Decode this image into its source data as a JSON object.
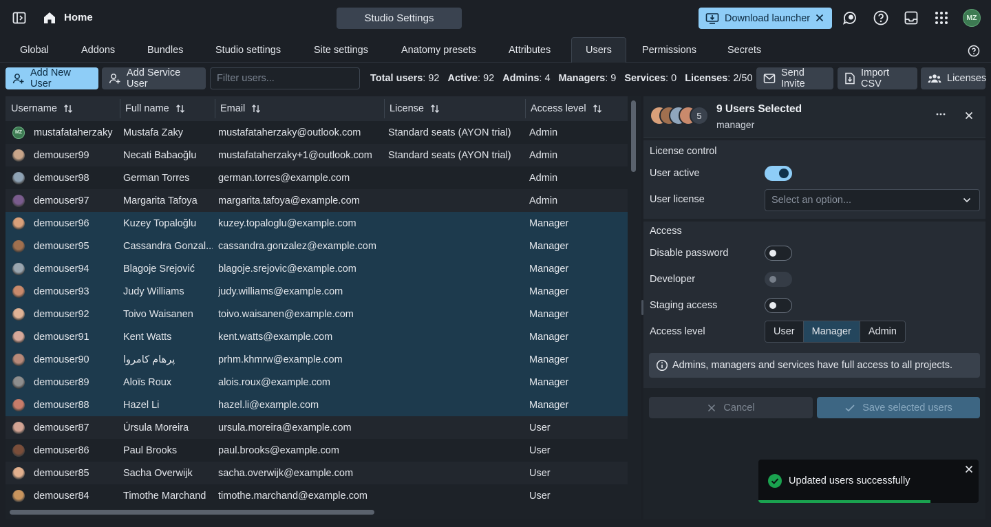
{
  "topbar": {
    "home_label": "Home",
    "title": "Studio Settings",
    "download_label": "Download launcher",
    "user_initials": "MZ"
  },
  "tabs": [
    {
      "label": "Global",
      "active": false
    },
    {
      "label": "Addons",
      "active": false
    },
    {
      "label": "Bundles",
      "active": false
    },
    {
      "label": "Studio settings",
      "active": false
    },
    {
      "label": "Site settings",
      "active": false
    },
    {
      "label": "Anatomy presets",
      "active": false
    },
    {
      "label": "Attributes",
      "active": false
    },
    {
      "label": "Users",
      "active": true
    },
    {
      "label": "Permissions",
      "active": false
    },
    {
      "label": "Secrets",
      "active": false
    }
  ],
  "toolbar": {
    "add_user": "Add New User",
    "add_service": "Add Service User",
    "filter_placeholder": "Filter users...",
    "stats": [
      {
        "label": "Total users",
        "value": "92"
      },
      {
        "label": "Active",
        "value": "92"
      },
      {
        "label": "Admins",
        "value": "4"
      },
      {
        "label": "Managers",
        "value": "9"
      },
      {
        "label": "Services",
        "value": "0"
      },
      {
        "label": "Licenses",
        "value": "2/50"
      }
    ],
    "send_invite": "Send Invite",
    "import_csv": "Import CSV",
    "licenses": "Licenses"
  },
  "table": {
    "columns": [
      "Username",
      "Full name",
      "Email",
      "License",
      "Access level"
    ],
    "rows": [
      {
        "username": "mustafataherzaky",
        "fullname": "Mustafa Zaky",
        "email": "mustafataherzaky@outlook.com",
        "license": "Standard seats (AYON trial)",
        "access": "Admin",
        "selected": false,
        "avatar": "mz"
      },
      {
        "username": "demouser99",
        "fullname": "Necati Babaoğlu",
        "email": "mustafataherzaky+1@outlook.com",
        "license": "Standard seats (AYON trial)",
        "access": "Admin",
        "selected": false,
        "avatar": "#c8a58a"
      },
      {
        "username": "demouser98",
        "fullname": "German Torres",
        "email": "german.torres@example.com",
        "license": "",
        "access": "Admin",
        "selected": false,
        "avatar": "#8fa3b5"
      },
      {
        "username": "demouser97",
        "fullname": "Margarita Tafoya",
        "email": "margarita.tafoya@example.com",
        "license": "",
        "access": "Admin",
        "selected": false,
        "avatar": "#7a5c8e"
      },
      {
        "username": "demouser96",
        "fullname": "Kuzey Topaloğlu",
        "email": "kuzey.topaloglu@example.com",
        "license": "",
        "access": "Manager",
        "selected": true,
        "avatar": "#d9a07a"
      },
      {
        "username": "demouser95",
        "fullname": "Cassandra Gonzal...",
        "email": "cassandra.gonzalez@example.com",
        "license": "",
        "access": "Manager",
        "selected": true,
        "avatar": "#a0704f"
      },
      {
        "username": "demouser94",
        "fullname": "Blagoje Srejović",
        "email": "blagoje.srejovic@example.com",
        "license": "",
        "access": "Manager",
        "selected": true,
        "avatar": "#9aa6b0"
      },
      {
        "username": "demouser93",
        "fullname": "Judy Williams",
        "email": "judy.williams@example.com",
        "license": "",
        "access": "Manager",
        "selected": true,
        "avatar": "#c98a6c"
      },
      {
        "username": "demouser92",
        "fullname": "Toivo Waisanen",
        "email": "toivo.waisanen@example.com",
        "license": "",
        "access": "Manager",
        "selected": true,
        "avatar": "#e0b396"
      },
      {
        "username": "demouser91",
        "fullname": "Kent Watts",
        "email": "kent.watts@example.com",
        "license": "",
        "access": "Manager",
        "selected": true,
        "avatar": "#d6a89a"
      },
      {
        "username": "demouser90",
        "fullname": "پرهام کامروا",
        "email": "prhm.khmrw@example.com",
        "license": "",
        "access": "Manager",
        "selected": true,
        "avatar": "#b88a7a"
      },
      {
        "username": "demouser89",
        "fullname": "Aloïs Roux",
        "email": "alois.roux@example.com",
        "license": "",
        "access": "Manager",
        "selected": true,
        "avatar": "#8e8e8e"
      },
      {
        "username": "demouser88",
        "fullname": "Hazel Li",
        "email": "hazel.li@example.com",
        "license": "",
        "access": "Manager",
        "selected": true,
        "avatar": "#c87c6a"
      },
      {
        "username": "demouser87",
        "fullname": "Úrsula Moreira",
        "email": "ursula.moreira@example.com",
        "license": "",
        "access": "User",
        "selected": false,
        "avatar": "#d3a494"
      },
      {
        "username": "demouser86",
        "fullname": "Paul Brooks",
        "email": "paul.brooks@example.com",
        "license": "",
        "access": "User",
        "selected": false,
        "avatar": "#7a4e3a"
      },
      {
        "username": "demouser85",
        "fullname": "Sacha Overwijk",
        "email": "sacha.overwijk@example.com",
        "license": "",
        "access": "User",
        "selected": false,
        "avatar": "#e2b08e"
      },
      {
        "username": "demouser84",
        "fullname": "Timothe Marchand",
        "email": "timothe.marchand@example.com",
        "license": "",
        "access": "User",
        "selected": false,
        "avatar": "#c9955e"
      }
    ]
  },
  "panel": {
    "title": "9 Users Selected",
    "subtitle": "manager",
    "extra_count": "5",
    "license_section": "License control",
    "user_active_label": "User active",
    "user_active": true,
    "user_license_label": "User license",
    "user_license_placeholder": "Select an option...",
    "access_section": "Access",
    "disable_password_label": "Disable password",
    "developer_label": "Developer",
    "staging_label": "Staging access",
    "access_level_label": "Access level",
    "access_levels": [
      "User",
      "Manager",
      "Admin"
    ],
    "access_level_selected": "Manager",
    "info": "Admins, managers and services have full access to all projects.",
    "cancel": "Cancel",
    "save": "Save selected users"
  },
  "toast": {
    "message": "Updated users successfully",
    "progress": 0.78
  },
  "colors": {
    "accent": "#8ecdf7",
    "selected_row": "#1d3a4d",
    "success": "#1aa24f"
  }
}
